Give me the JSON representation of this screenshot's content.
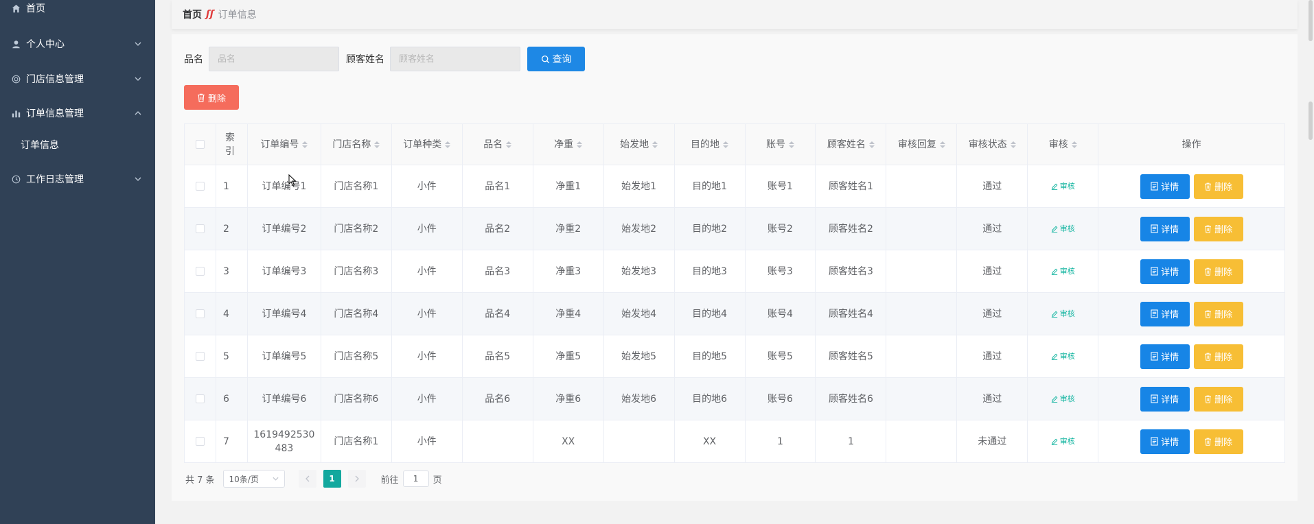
{
  "sidebar": {
    "items": [
      {
        "label": "首页",
        "icon": "home-icon"
      },
      {
        "label": "个人中心",
        "icon": "user-icon"
      },
      {
        "label": "门店信息管理",
        "icon": "store-icon"
      },
      {
        "label": "订单信息管理",
        "icon": "bar-chart-icon"
      },
      {
        "label": "订单信息",
        "icon": ""
      },
      {
        "label": "工作日志管理",
        "icon": "clock-icon"
      }
    ]
  },
  "breadcrumb": {
    "home": "首页",
    "current": "订单信息"
  },
  "search": {
    "field1_label": "品名",
    "field1_placeholder": "品名",
    "field2_label": "顾客姓名",
    "field2_placeholder": "顾客姓名",
    "query_button": "查询"
  },
  "actions": {
    "delete_button": "删除"
  },
  "table": {
    "columns": [
      "索引",
      "订单编号",
      "门店名称",
      "订单种类",
      "品名",
      "净重",
      "始发地",
      "目的地",
      "账号",
      "顾客姓名",
      "审核回复",
      "审核状态",
      "审核",
      "操作"
    ],
    "rows": [
      [
        "1",
        "订单编号1",
        "门店名称1",
        "小件",
        "品名1",
        "净重1",
        "始发地1",
        "目的地1",
        "账号1",
        "顾客姓名1",
        "",
        "通过"
      ],
      [
        "2",
        "订单编号2",
        "门店名称2",
        "小件",
        "品名2",
        "净重2",
        "始发地2",
        "目的地2",
        "账号2",
        "顾客姓名2",
        "",
        "通过"
      ],
      [
        "3",
        "订单编号3",
        "门店名称3",
        "小件",
        "品名3",
        "净重3",
        "始发地3",
        "目的地3",
        "账号3",
        "顾客姓名3",
        "",
        "通过"
      ],
      [
        "4",
        "订单编号4",
        "门店名称4",
        "小件",
        "品名4",
        "净重4",
        "始发地4",
        "目的地4",
        "账号4",
        "顾客姓名4",
        "",
        "通过"
      ],
      [
        "5",
        "订单编号5",
        "门店名称5",
        "小件",
        "品名5",
        "净重5",
        "始发地5",
        "目的地5",
        "账号5",
        "顾客姓名5",
        "",
        "通过"
      ],
      [
        "6",
        "订单编号6",
        "门店名称6",
        "小件",
        "品名6",
        "净重6",
        "始发地6",
        "目的地6",
        "账号6",
        "顾客姓名6",
        "",
        "通过"
      ],
      [
        "7",
        "1619492530483",
        "门店名称1",
        "小件",
        "",
        "XX",
        "",
        "XX",
        "1",
        "1",
        "",
        "未通过"
      ]
    ],
    "audit_label": "审核",
    "detail_label": "详情",
    "row_delete_label": "删除"
  },
  "pagination": {
    "total": "共 7 条",
    "page_size": "10条/页",
    "current_page": "1",
    "goto_prefix": "前往",
    "goto_value": "1",
    "goto_suffix": "页"
  },
  "colors": {
    "sidebar_bg": "#304156",
    "primary": "#1785e6",
    "danger": "#f56c5c",
    "warning": "#f7be35",
    "success": "#13a89e"
  }
}
